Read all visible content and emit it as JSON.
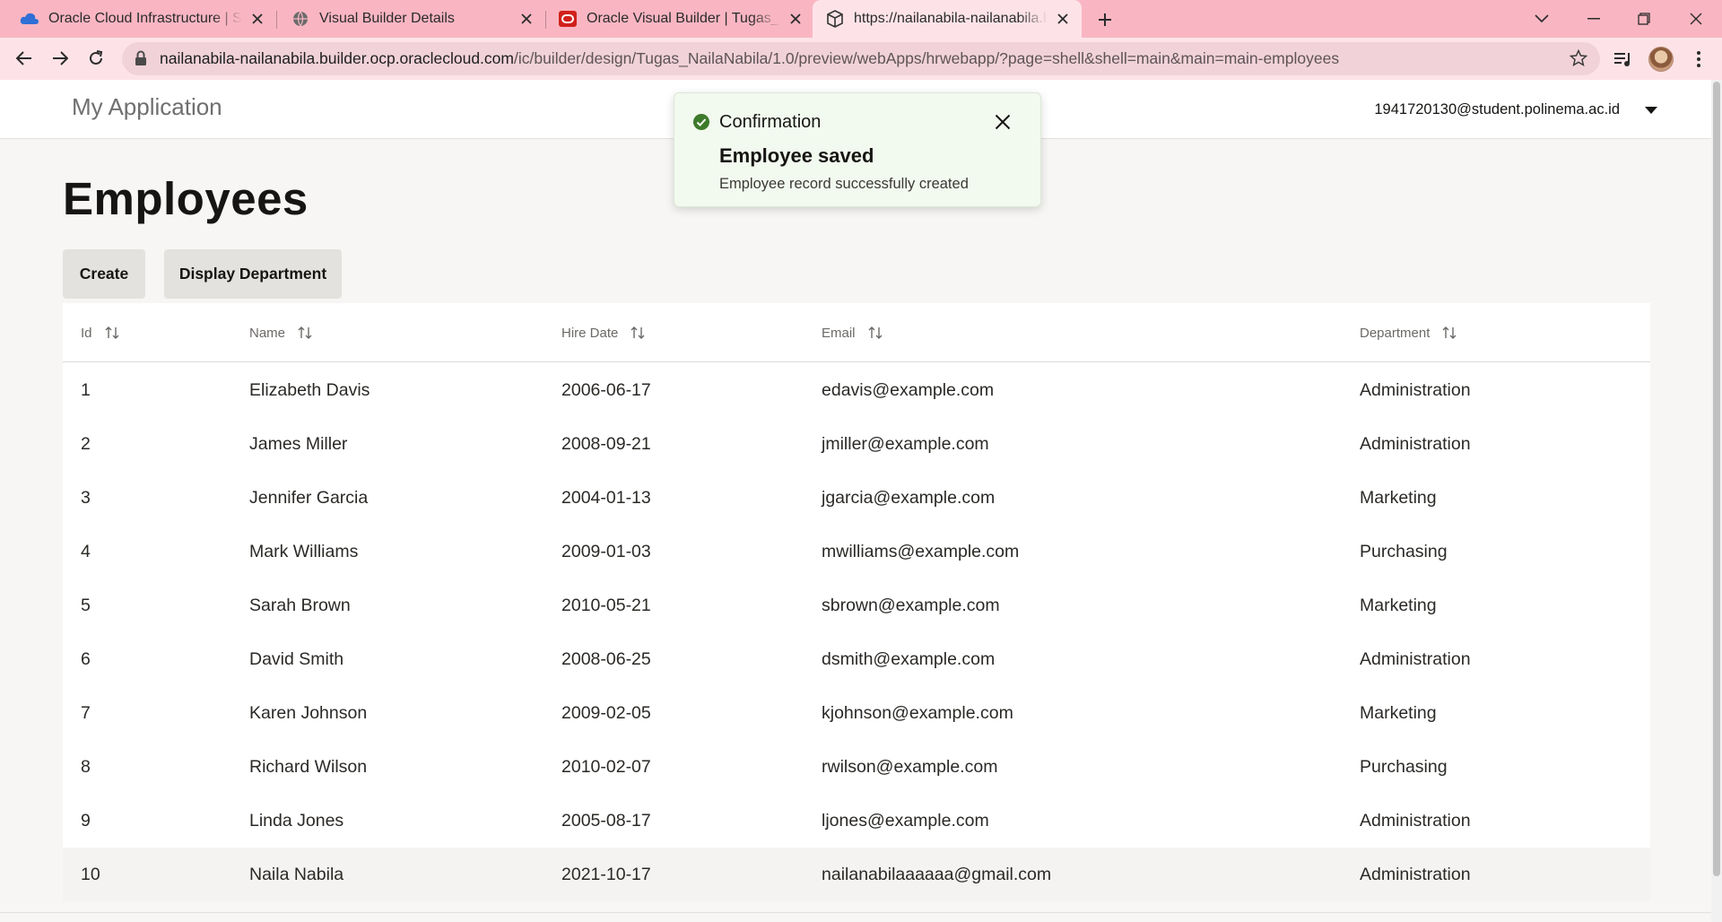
{
  "browser": {
    "tabs": [
      {
        "title": "Oracle Cloud Infrastructure | Sign In",
        "icon": "cloud-icon"
      },
      {
        "title": "Visual Builder Details",
        "icon": "globe-icon"
      },
      {
        "title": "Oracle Visual Builder | Tugas_NailaNabila",
        "icon": "oracle-icon"
      },
      {
        "title": "https://nailanabila-nailanabila.builder.ocp.oraclecloud.com",
        "icon": "cube-icon",
        "active": true
      }
    ],
    "url_host": "nailanabila-nailanabila.builder.ocp.oraclecloud.com",
    "url_path": "/ic/builder/design/Tugas_NailaNabila/1.0/preview/webApps/hrwebapp/?page=shell&shell=main&main=main-employees"
  },
  "app": {
    "title": "My Application",
    "user": "1941720130@student.polinema.ac.id"
  },
  "page": {
    "title": "Employees",
    "create_label": "Create",
    "display_department_label": "Display Department"
  },
  "table": {
    "columns": [
      "Id",
      "Name",
      "Hire Date",
      "Email",
      "Department"
    ],
    "rows": [
      {
        "id": "1",
        "name": "Elizabeth Davis",
        "hire_date": "2006-06-17",
        "email": "edavis@example.com",
        "department": "Administration"
      },
      {
        "id": "2",
        "name": "James Miller",
        "hire_date": "2008-09-21",
        "email": "jmiller@example.com",
        "department": "Administration"
      },
      {
        "id": "3",
        "name": "Jennifer Garcia",
        "hire_date": "2004-01-13",
        "email": "jgarcia@example.com",
        "department": "Marketing"
      },
      {
        "id": "4",
        "name": "Mark Williams",
        "hire_date": "2009-01-03",
        "email": "mwilliams@example.com",
        "department": "Purchasing"
      },
      {
        "id": "5",
        "name": "Sarah Brown",
        "hire_date": "2010-05-21",
        "email": "sbrown@example.com",
        "department": "Marketing"
      },
      {
        "id": "6",
        "name": "David Smith",
        "hire_date": "2008-06-25",
        "email": "dsmith@example.com",
        "department": "Administration"
      },
      {
        "id": "7",
        "name": "Karen Johnson",
        "hire_date": "2009-02-05",
        "email": "kjohnson@example.com",
        "department": "Marketing"
      },
      {
        "id": "8",
        "name": "Richard Wilson",
        "hire_date": "2010-02-07",
        "email": "rwilson@example.com",
        "department": "Purchasing"
      },
      {
        "id": "9",
        "name": "Linda Jones",
        "hire_date": "2005-08-17",
        "email": "ljones@example.com",
        "department": "Administration"
      },
      {
        "id": "10",
        "name": "Naila Nabila",
        "hire_date": "2021-10-17",
        "email": "nailanabilaaaaaa@gmail.com",
        "department": "Administration"
      }
    ]
  },
  "toast": {
    "header": "Confirmation",
    "summary": "Employee saved",
    "detail": "Employee record successfully created",
    "icon": "check-circle-icon"
  },
  "colors": {
    "tab_strip": "#f9b6c2",
    "toolbar": "#fde3e8",
    "toast_bg": "#f2f9ee",
    "success": "#3d7a2a",
    "page_bg": "#f7f6f4"
  }
}
